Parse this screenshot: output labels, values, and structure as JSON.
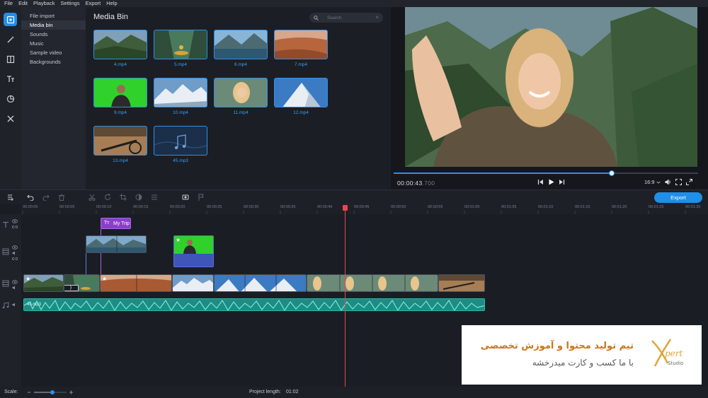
{
  "menu": [
    "File",
    "Edit",
    "Playback",
    "Settings",
    "Export",
    "Help"
  ],
  "side_menu": [
    "File import",
    "Media bin",
    "Sounds",
    "Music",
    "Sample video",
    "Backgrounds"
  ],
  "bin": {
    "title": "Media Bin",
    "search_placeholder": "Search",
    "items": [
      {
        "label": "4.mp4",
        "scene": "forest-valley"
      },
      {
        "label": "5.mp4",
        "scene": "kayak-canyon"
      },
      {
        "label": "6.mp4",
        "scene": "mountain-lake"
      },
      {
        "label": "7.mp4",
        "scene": "desert-dunes"
      },
      {
        "label": "9.mp4",
        "scene": "green-screen-man"
      },
      {
        "label": "10.mp4",
        "scene": "snowy-peaks"
      },
      {
        "label": "11.mp4",
        "scene": "selfie-woman"
      },
      {
        "label": "12.mp4",
        "scene": "snow-peak-blue"
      },
      {
        "label": "13.mp4",
        "scene": "bike-ride"
      },
      {
        "label": "45.mp3",
        "scene": "audio-file"
      }
    ]
  },
  "preview": {
    "timecode_main": "00:00:43",
    "timecode_frac": ".700",
    "aspect": "16:9",
    "progress_fraction": 0.71
  },
  "toolbar": {
    "export_label": "Export"
  },
  "ruler_ticks": [
    "00:00:00",
    "00:00:05",
    "00:00:10",
    "00:00:15",
    "00:00:20",
    "00:00:25",
    "00:00:30",
    "00:00:35",
    "00:00:40",
    "00:00:45",
    "00:00:50",
    "00:00:55",
    "00:01:00",
    "00:01:05",
    "00:01:10",
    "00:01:15",
    "00:01:20",
    "00:01:25",
    "00:01:30"
  ],
  "title_clip_label": "My Trip",
  "audio_clip_label": "45.mp3",
  "bottom": {
    "scale_label": "Scale:",
    "project_length_label": "Project length:",
    "project_length_value": "01:02"
  },
  "watermark": {
    "line1": "تیم تولید محتوا و آموزش تخصصی",
    "line2": "با ما کسب و کارت میدرخشه",
    "logo_text": "Xpert Studio"
  },
  "colors": {
    "accent": "#1f8fe8",
    "playhead": "#e5484d",
    "title_clip": "#8a3fc9",
    "audio_clip": "#1fa79a"
  }
}
